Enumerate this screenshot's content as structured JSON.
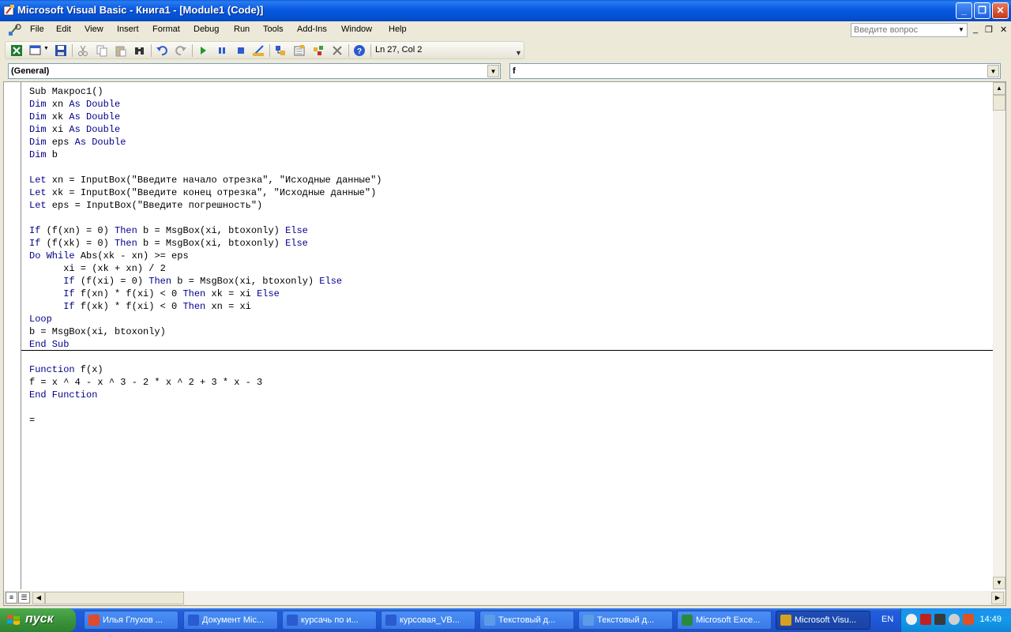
{
  "window": {
    "title": "Microsoft Visual Basic - Книга1 - [Module1 (Code)]",
    "minimize": "_",
    "restore": "❐",
    "close": "✕"
  },
  "menu": {
    "items": [
      "File",
      "Edit",
      "View",
      "Insert",
      "Format",
      "Debug",
      "Run",
      "Tools",
      "Add-Ins",
      "Window",
      "Help"
    ],
    "help_placeholder": "Введите вопрос",
    "mdi_minimize": "_",
    "mdi_restore": "❐",
    "mdi_close": "✕"
  },
  "toolbar": {
    "cursor_position": "Ln 27, Col 2",
    "icons": [
      "excel-icon",
      "insert-userform-icon",
      "save-icon",
      "cut-icon",
      "copy-icon",
      "paste-icon",
      "find-icon",
      "undo-icon",
      "redo-icon",
      "run-icon",
      "break-icon",
      "reset-icon",
      "design-mode-icon",
      "project-explorer-icon",
      "properties-icon",
      "object-browser-icon",
      "toolbox-icon",
      "help-icon"
    ]
  },
  "combos": {
    "object": "(General)",
    "procedure": "f"
  },
  "code": {
    "lines": [
      [
        {
          "t": "Sub Макрос1()",
          "k": false
        }
      ],
      [
        {
          "t": "Dim",
          "k": true
        },
        {
          "t": " xn ",
          "k": false
        },
        {
          "t": "As",
          "k": true
        },
        {
          "t": " ",
          "k": false
        },
        {
          "t": "Double",
          "k": true
        }
      ],
      [
        {
          "t": "Dim",
          "k": true
        },
        {
          "t": " xk ",
          "k": false
        },
        {
          "t": "As",
          "k": true
        },
        {
          "t": " ",
          "k": false
        },
        {
          "t": "Double",
          "k": true
        }
      ],
      [
        {
          "t": "Dim",
          "k": true
        },
        {
          "t": " xi ",
          "k": false
        },
        {
          "t": "As",
          "k": true
        },
        {
          "t": " ",
          "k": false
        },
        {
          "t": "Double",
          "k": true
        }
      ],
      [
        {
          "t": "Dim",
          "k": true
        },
        {
          "t": " eps ",
          "k": false
        },
        {
          "t": "As",
          "k": true
        },
        {
          "t": " ",
          "k": false
        },
        {
          "t": "Double",
          "k": true
        }
      ],
      [
        {
          "t": "Dim",
          "k": true
        },
        {
          "t": " b",
          "k": false
        }
      ],
      [
        {
          "t": "",
          "k": false
        }
      ],
      [
        {
          "t": "Let",
          "k": true
        },
        {
          "t": " xn = InputBox(\"Введите начало отрезка\", \"Исходные данные\")",
          "k": false
        }
      ],
      [
        {
          "t": "Let",
          "k": true
        },
        {
          "t": " xk = InputBox(\"Введите конец отрезка\", \"Исходные данные\")",
          "k": false
        }
      ],
      [
        {
          "t": "Let",
          "k": true
        },
        {
          "t": " eps = InputBox(\"Введите погрешность\")",
          "k": false
        }
      ],
      [
        {
          "t": "",
          "k": false
        }
      ],
      [
        {
          "t": "If",
          "k": true
        },
        {
          "t": " (f(xn) = 0) ",
          "k": false
        },
        {
          "t": "Then",
          "k": true
        },
        {
          "t": " b = MsgBox(xi, btoxonly) ",
          "k": false
        },
        {
          "t": "Else",
          "k": true
        }
      ],
      [
        {
          "t": "If",
          "k": true
        },
        {
          "t": " (f(xk) = 0) ",
          "k": false
        },
        {
          "t": "Then",
          "k": true
        },
        {
          "t": " b = MsgBox(xi, btoxonly) ",
          "k": false
        },
        {
          "t": "Else",
          "k": true
        }
      ],
      [
        {
          "t": "Do",
          "k": true
        },
        {
          "t": " ",
          "k": false
        },
        {
          "t": "While",
          "k": true
        },
        {
          "t": " Abs(xk - xn) >= eps",
          "k": false
        }
      ],
      [
        {
          "t": "      xi = (xk + xn) / 2",
          "k": false
        }
      ],
      [
        {
          "t": "      ",
          "k": false
        },
        {
          "t": "If",
          "k": true
        },
        {
          "t": " (f(xi) = 0) ",
          "k": false
        },
        {
          "t": "Then",
          "k": true
        },
        {
          "t": " b = MsgBox(xi, btoxonly) ",
          "k": false
        },
        {
          "t": "Else",
          "k": true
        }
      ],
      [
        {
          "t": "      ",
          "k": false
        },
        {
          "t": "If",
          "k": true
        },
        {
          "t": " f(xn) * f(xi) < 0 ",
          "k": false
        },
        {
          "t": "Then",
          "k": true
        },
        {
          "t": " xk = xi ",
          "k": false
        },
        {
          "t": "Else",
          "k": true
        }
      ],
      [
        {
          "t": "      ",
          "k": false
        },
        {
          "t": "If",
          "k": true
        },
        {
          "t": " f(xk) * f(xi) < 0 ",
          "k": false
        },
        {
          "t": "Then",
          "k": true
        },
        {
          "t": " xn = xi",
          "k": false
        }
      ],
      [
        {
          "t": "Loop",
          "k": true
        }
      ],
      [
        {
          "t": "b = MsgBox(xi, btoxonly)",
          "k": false
        }
      ],
      [
        {
          "t": "End Sub",
          "k": true
        }
      ],
      [
        {
          "t": "",
          "k": false
        }
      ],
      [
        {
          "t": "Function",
          "k": true
        },
        {
          "t": " f(x)",
          "k": false
        }
      ],
      [
        {
          "t": "f = x ^ 4 - x ^ 3 - 2 * x ^ 2 + 3 * x - 3",
          "k": false
        }
      ],
      [
        {
          "t": "End Function",
          "k": true
        }
      ],
      [
        {
          "t": "",
          "k": false
        }
      ],
      [
        {
          "t": "=",
          "k": false
        }
      ]
    ]
  },
  "taskbar": {
    "start_label": "пуск",
    "tasks": [
      {
        "label": "Илья Глухов ...",
        "icon_color": "#e04a2a",
        "active": false
      },
      {
        "label": "Документ Mic...",
        "icon_color": "#2a5bd0",
        "active": false
      },
      {
        "label": "курсачь по и...",
        "icon_color": "#2a5bd0",
        "active": false
      },
      {
        "label": "курсовая_VB...",
        "icon_color": "#2a5bd0",
        "active": false
      },
      {
        "label": "Текстовый д...",
        "icon_color": "#5b9be8",
        "active": false
      },
      {
        "label": "Текстовый д...",
        "icon_color": "#5b9be8",
        "active": false
      },
      {
        "label": "Microsoft Exce...",
        "icon_color": "#2a8a3a",
        "active": false
      },
      {
        "label": "Microsoft Visu...",
        "icon_color": "#d8a020",
        "active": true
      }
    ],
    "language": "EN",
    "clock": "14:49"
  }
}
